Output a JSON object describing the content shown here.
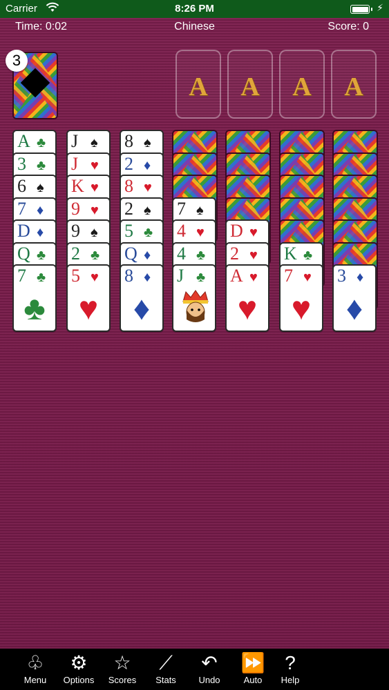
{
  "status_bar": {
    "carrier": "Carrier",
    "time": "8:26 PM"
  },
  "hud": {
    "time": "Time: 0:02",
    "mode": "Chinese",
    "score": "Score: 0"
  },
  "stock": {
    "count": "3"
  },
  "foundations": [
    "A",
    "A",
    "A",
    "A"
  ],
  "tableau": [
    {
      "cards": [
        {
          "rank": "A",
          "suit": "♣",
          "color": "green"
        },
        {
          "rank": "3",
          "suit": "♣",
          "color": "green"
        },
        {
          "rank": "6",
          "suit": "♠",
          "color": "black"
        },
        {
          "rank": "7",
          "suit": "♦",
          "color": "blue"
        },
        {
          "rank": "D",
          "suit": "♦",
          "color": "blue"
        },
        {
          "rank": "Q",
          "suit": "♣",
          "color": "green"
        },
        {
          "rank": "7",
          "suit": "♣",
          "color": "green"
        }
      ]
    },
    {
      "cards": [
        {
          "rank": "J",
          "suit": "♠",
          "color": "black"
        },
        {
          "rank": "J",
          "suit": "♥",
          "color": "red"
        },
        {
          "rank": "K",
          "suit": "♥",
          "color": "red"
        },
        {
          "rank": "9",
          "suit": "♥",
          "color": "red"
        },
        {
          "rank": "9",
          "suit": "♠",
          "color": "black"
        },
        {
          "rank": "2",
          "suit": "♣",
          "color": "green"
        },
        {
          "rank": "5",
          "suit": "♥",
          "color": "red"
        }
      ]
    },
    {
      "cards": [
        {
          "rank": "8",
          "suit": "♠",
          "color": "black"
        },
        {
          "rank": "2",
          "suit": "♦",
          "color": "blue"
        },
        {
          "rank": "8",
          "suit": "♥",
          "color": "red"
        },
        {
          "rank": "2",
          "suit": "♠",
          "color": "black"
        },
        {
          "rank": "5",
          "suit": "♣",
          "color": "green"
        },
        {
          "rank": "Q",
          "suit": "♦",
          "color": "blue"
        },
        {
          "rank": "8",
          "suit": "♦",
          "color": "blue"
        }
      ]
    },
    {
      "face_down": 3,
      "cards": [
        {
          "rank": "7",
          "suit": "♠",
          "color": "black"
        },
        {
          "rank": "4",
          "suit": "♥",
          "color": "red"
        },
        {
          "rank": "4",
          "suit": "♣",
          "color": "green"
        },
        {
          "rank": "J",
          "suit": "♣",
          "color": "green",
          "face": "king"
        }
      ]
    },
    {
      "face_down": 4,
      "cards": [
        {
          "rank": "D",
          "suit": "♥",
          "color": "red"
        },
        {
          "rank": "2",
          "suit": "♥",
          "color": "red"
        },
        {
          "rank": "A",
          "suit": "♥",
          "color": "red"
        }
      ]
    },
    {
      "face_down": 5,
      "cards": [
        {
          "rank": "K",
          "suit": "♣",
          "color": "green"
        },
        {
          "rank": "7",
          "suit": "♥",
          "color": "red"
        }
      ]
    },
    {
      "face_down": 6,
      "cards": [
        {
          "rank": "3",
          "suit": "♦",
          "color": "blue"
        }
      ]
    }
  ],
  "toolbar": [
    {
      "label": "Menu",
      "icon": "menu-suits-icon",
      "glyph": "♧"
    },
    {
      "label": "Options",
      "icon": "gears-icon",
      "glyph": "⚙"
    },
    {
      "label": "Scores",
      "icon": "star-icon",
      "glyph": "☆"
    },
    {
      "label": "Stats",
      "icon": "chart-line-icon",
      "glyph": "⟋"
    },
    {
      "label": "Undo",
      "icon": "undo-icon",
      "glyph": "↶"
    },
    {
      "label": "Auto",
      "icon": "fast-forward-icon",
      "glyph": "⏩"
    },
    {
      "label": "Help",
      "icon": "question-icon",
      "glyph": "?"
    }
  ]
}
